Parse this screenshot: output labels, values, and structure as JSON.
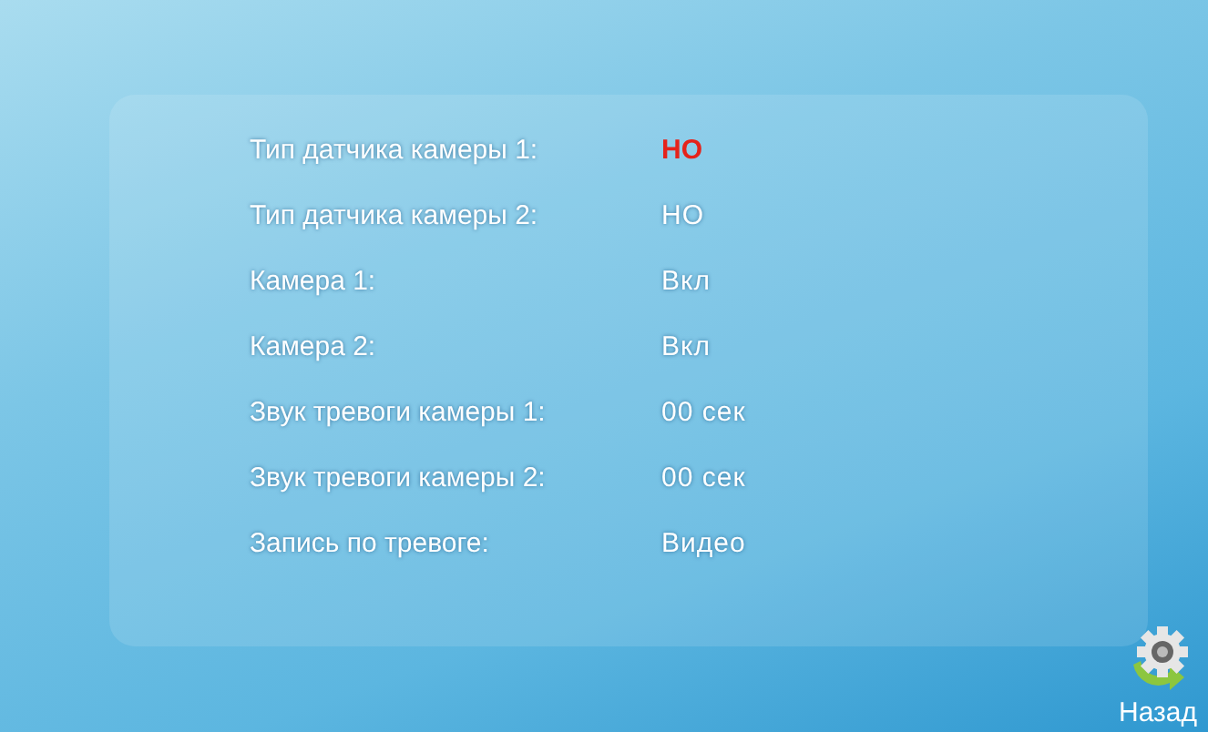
{
  "settings": [
    {
      "label": "Тип датчика камеры 1:",
      "value": "НО",
      "selected": true
    },
    {
      "label": "Тип датчика камеры 2:",
      "value": "НО",
      "selected": false
    },
    {
      "label": "Камера 1:",
      "value": "Вкл",
      "selected": false
    },
    {
      "label": "Камера 2:",
      "value": "Вкл",
      "selected": false
    },
    {
      "label": "Звук тревоги камеры 1:",
      "value": "00 сек",
      "selected": false
    },
    {
      "label": "Звук тревоги камеры 2:",
      "value": "00 сек",
      "selected": false
    },
    {
      "label": "Запись по тревоге:",
      "value": "Видео",
      "selected": false
    }
  ],
  "back_button": {
    "label": "Назад"
  }
}
